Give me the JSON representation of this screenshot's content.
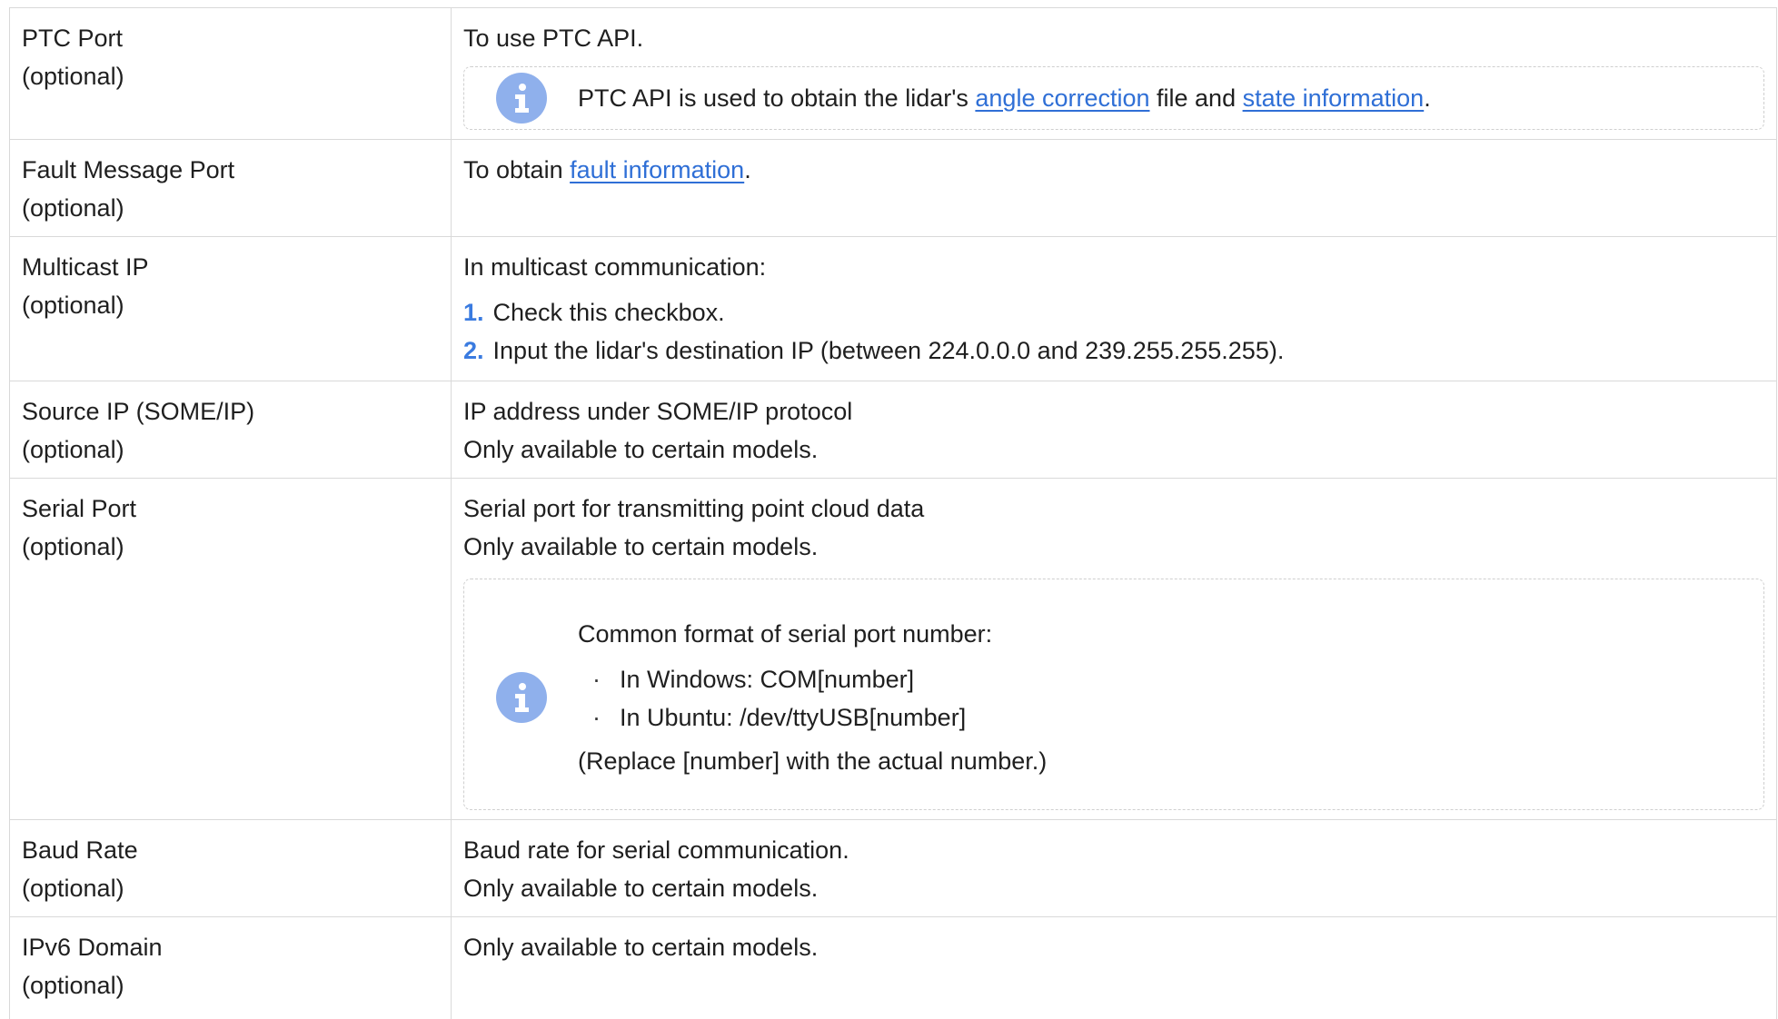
{
  "rows": [
    {
      "name": "PTC Port",
      "qualifier": "(optional)",
      "desc": "To use PTC API.",
      "note": {
        "pre": "PTC API is used to obtain the lidar's ",
        "link1": "angle correction",
        "mid": " file and ",
        "link2": "state information",
        "post": "."
      }
    },
    {
      "name": "Fault Message Port",
      "qualifier": "(optional)",
      "desc_pre": "To obtain ",
      "desc_link": "fault information",
      "desc_post": "."
    },
    {
      "name": "Multicast IP",
      "qualifier": "(optional)",
      "desc": "In multicast communication:",
      "steps": [
        {
          "num": "1.",
          "text": "Check this checkbox."
        },
        {
          "num": "2.",
          "text": "Input the lidar's destination IP (between 224.0.0.0 and 239.255.255.255)."
        }
      ]
    },
    {
      "name": "Source IP (SOME/IP)",
      "qualifier": "(optional)",
      "desc1": "IP address under SOME/IP protocol",
      "desc2": "Only available to certain models."
    },
    {
      "name": "Serial Port",
      "qualifier": "(optional)",
      "desc1": "Serial port for transmitting point cloud data",
      "desc2": "Only available to certain models.",
      "note": {
        "heading": "Common format of serial port number:",
        "bullets": [
          "In Windows: COM[number]",
          "In Ubuntu: /dev/ttyUSB[number]"
        ],
        "footer": "(Replace [number] with the actual number.)"
      }
    },
    {
      "name": "Baud Rate",
      "qualifier": "(optional)",
      "desc1": "Baud rate for serial communication.",
      "desc2": "Only available to certain models."
    },
    {
      "name": "IPv6 Domain",
      "qualifier": "(optional)",
      "desc": "Only available to certain models."
    }
  ],
  "icons": {
    "info": "info-icon",
    "bullet": "·"
  },
  "colors": {
    "link": "#2f6fd6",
    "step_number": "#3a7be0",
    "info_icon": "#8fb0ec",
    "border": "#d9d9d9"
  }
}
